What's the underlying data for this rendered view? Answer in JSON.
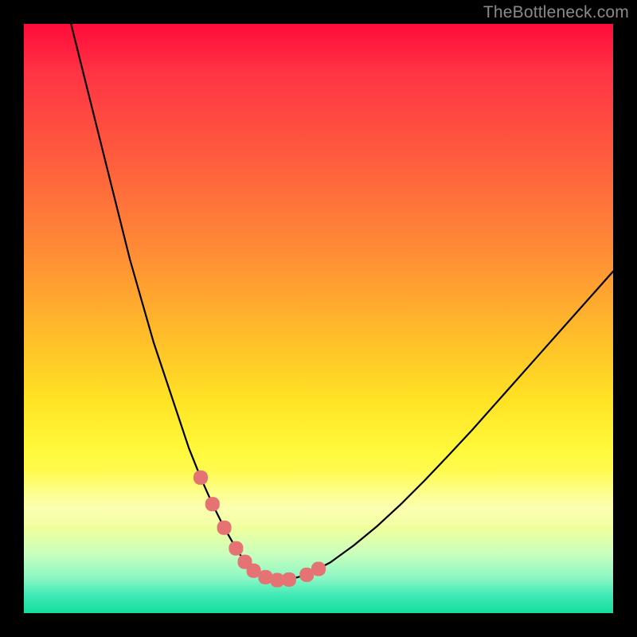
{
  "watermark": "TheBottleneck.com",
  "colors": {
    "background": "#000000",
    "gradient_top": "#ff0b3a",
    "gradient_mid1": "#ff8a36",
    "gradient_mid2": "#ffe324",
    "gradient_bottom": "#14dd9d",
    "curve": "#000000",
    "marker": "#e57373"
  },
  "chart_data": {
    "type": "line",
    "title": "",
    "xlabel": "",
    "ylabel": "",
    "xlim": [
      0,
      100
    ],
    "ylim": [
      0,
      100
    ],
    "grid": false,
    "legend": false,
    "series": [
      {
        "name": "bottleneck-curve",
        "x": [
          8,
          10,
          12,
          14,
          16,
          18,
          20,
          22,
          24,
          26,
          28,
          30,
          32,
          34,
          36,
          37.5,
          39,
          41,
          43,
          45,
          48,
          52,
          56,
          60,
          64,
          68,
          72,
          76,
          80,
          84,
          88,
          92,
          96,
          100
        ],
        "y": [
          100,
          92,
          84,
          76,
          68,
          60,
          53,
          46,
          40,
          34,
          28,
          23,
          18.5,
          14.5,
          11,
          8.7,
          7.2,
          6.1,
          5.6,
          5.7,
          6.5,
          8.6,
          11.5,
          14.8,
          18.5,
          22.5,
          26.7,
          31,
          35.5,
          40,
          44.5,
          49,
          53.5,
          58
        ]
      },
      {
        "name": "highlight-markers",
        "x": [
          30,
          32,
          34,
          36,
          37.5,
          39,
          41,
          43,
          45,
          48,
          50
        ],
        "y": [
          23,
          18.5,
          14.5,
          11,
          8.7,
          7.2,
          6.1,
          5.6,
          5.7,
          6.5,
          7.5
        ]
      }
    ],
    "annotations": []
  }
}
